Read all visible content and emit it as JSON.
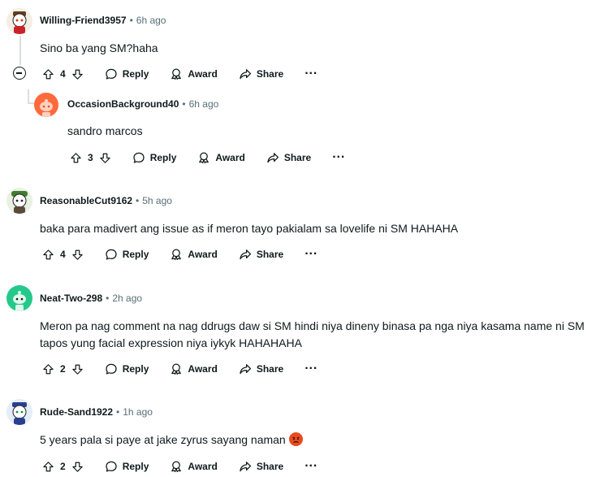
{
  "comments": [
    {
      "username": "Willing-Friend3957",
      "separator": "•",
      "time": "6h ago",
      "body": "Sino ba yang SM?haha",
      "votes": "4",
      "reply": "Reply",
      "award": "Award",
      "share": "Share",
      "more": "···"
    },
    {
      "username": "OccasionBackground40",
      "separator": "•",
      "time": "6h ago",
      "body": "sandro marcos",
      "votes": "3",
      "reply": "Reply",
      "award": "Award",
      "share": "Share",
      "more": "···"
    },
    {
      "username": "ReasonableCut9162",
      "separator": "•",
      "time": "5h ago",
      "body": "baka para madivert ang issue as if meron tayo pakialam sa lovelife ni SM HAHAHA",
      "votes": "4",
      "reply": "Reply",
      "award": "Award",
      "share": "Share",
      "more": "···"
    },
    {
      "username": "Neat-Two-298",
      "separator": "•",
      "time": "2h ago",
      "body": "Meron pa nag comment na nag ddrugs daw si SM hindi niya dineny binasa pa nga niya kasama name ni SM tapos yung facial expression niya iykyk HAHAHAHA",
      "votes": "2",
      "reply": "Reply",
      "award": "Award",
      "share": "Share",
      "more": "···"
    },
    {
      "username": "Rude-Sand1922",
      "separator": "•",
      "time": "1h ago",
      "body": "5 years pala si paye at jake zyrus sayang naman",
      "votes": "2",
      "reply": "Reply",
      "award": "Award",
      "share": "Share",
      "more": "···"
    }
  ],
  "icons": {
    "upvote": "upvote-icon",
    "downvote": "downvote-icon",
    "reply": "comment-icon",
    "award": "award-icon",
    "share": "share-icon",
    "collapse": "collapse-minus-icon",
    "emoji": "angry-face-emoji"
  },
  "colors": {
    "text": "#0f1a1c",
    "meta": "#576f76",
    "thread": "#d9dfe1",
    "emoji": "#e64c1f"
  }
}
